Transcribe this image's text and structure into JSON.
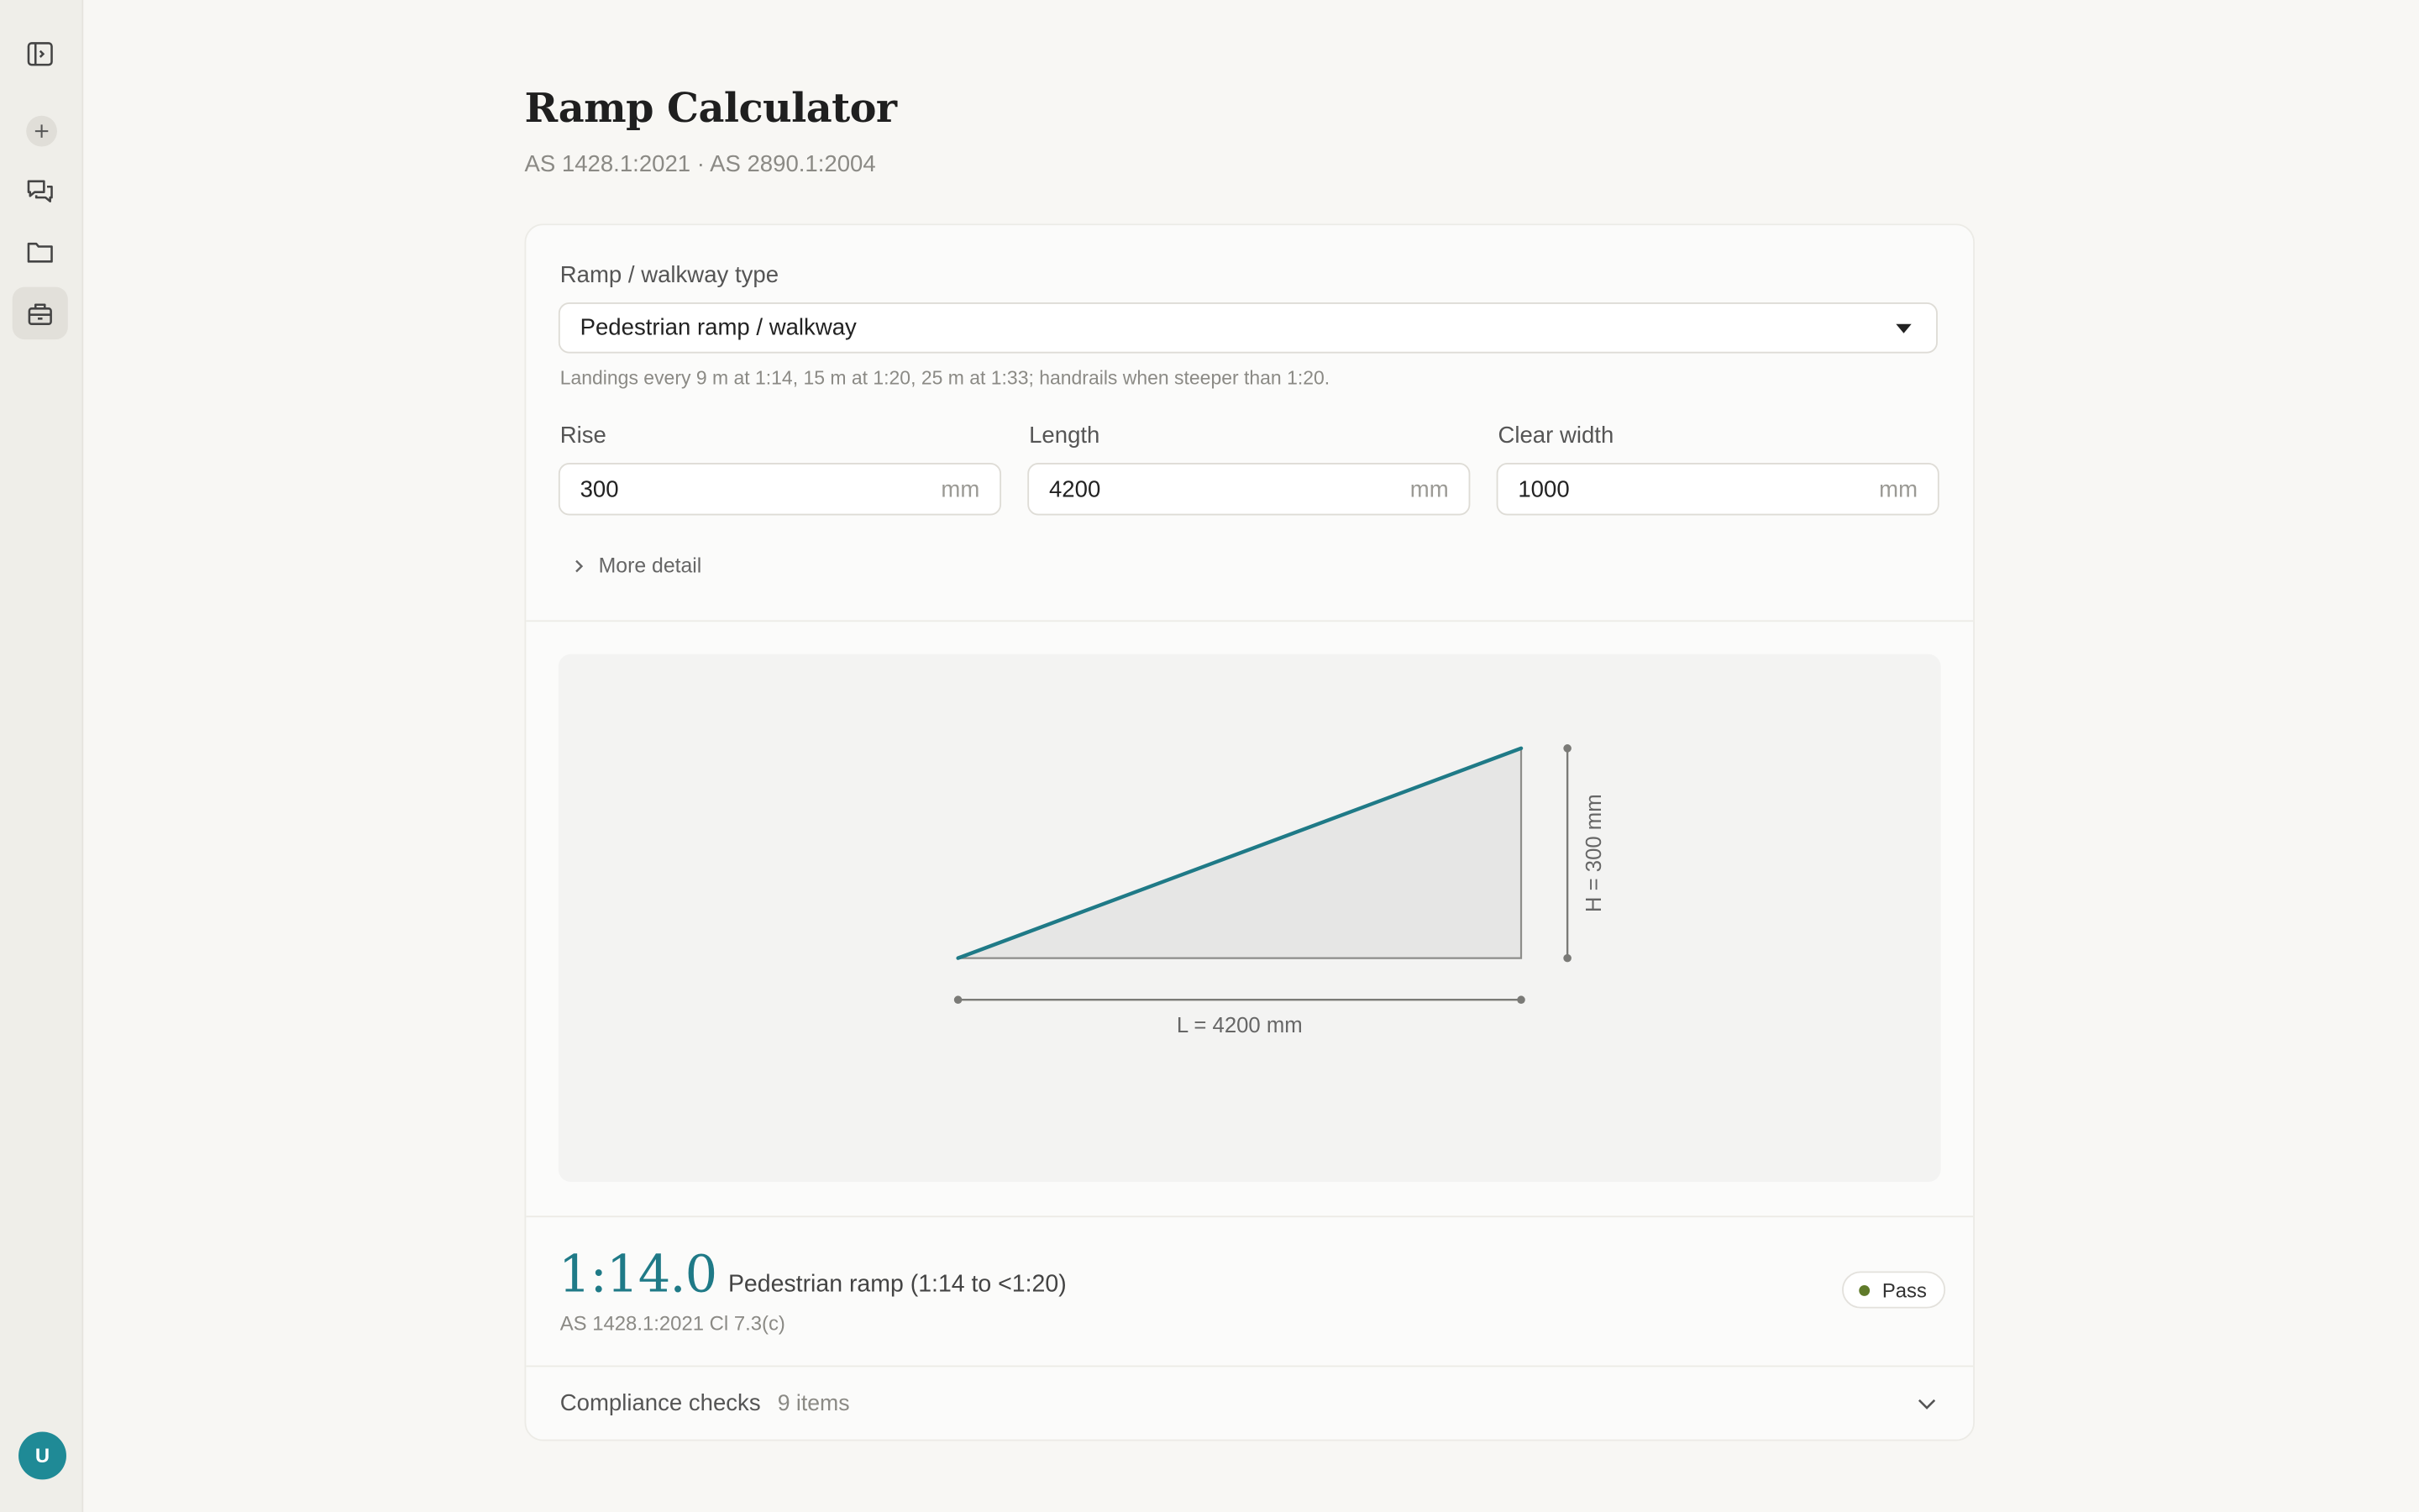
{
  "sidebar": {
    "items": [
      {
        "name": "toggle-sidebar",
        "icon": "panel-toggle-icon"
      },
      {
        "name": "new",
        "icon": "plus-icon"
      },
      {
        "name": "chats",
        "icon": "chat-bubbles-icon"
      },
      {
        "name": "projects",
        "icon": "folder-icon"
      },
      {
        "name": "tools",
        "icon": "toolbox-icon",
        "active": true
      }
    ],
    "avatar_initial": "U"
  },
  "header": {
    "title": "Ramp Calculator",
    "subtitle": "AS 1428.1:2021 · AS 2890.1:2004"
  },
  "form": {
    "type_label": "Ramp / walkway type",
    "type_value": "Pedestrian ramp / walkway",
    "type_hint": "Landings every 9 m at 1:14, 15 m at 1:20, 25 m at 1:33; handrails when steeper than 1:20.",
    "rise": {
      "label": "Rise",
      "value": "300",
      "unit": "mm"
    },
    "length": {
      "label": "Length",
      "value": "4200",
      "unit": "mm"
    },
    "width": {
      "label": "Clear width",
      "value": "1000",
      "unit": "mm"
    },
    "more_detail": "More detail"
  },
  "diagram": {
    "rise_mm": 300,
    "length_mm": 4200,
    "length_label": "L = 4200 mm",
    "height_label": "H = 300 mm",
    "slope_color": "#1f7a87"
  },
  "result": {
    "ratio": "1:14.0",
    "classification": "Pedestrian ramp (1:14 to <1:20)",
    "clause": "AS 1428.1:2021 Cl 7.3(c)",
    "status": "Pass",
    "status_color": "#5f7a2a"
  },
  "checks": {
    "label": "Compliance checks",
    "count": "9 items"
  },
  "colors": {
    "accent": "#1f7a87",
    "avatar": "#1f8a96",
    "background": "#f8f7f4"
  }
}
